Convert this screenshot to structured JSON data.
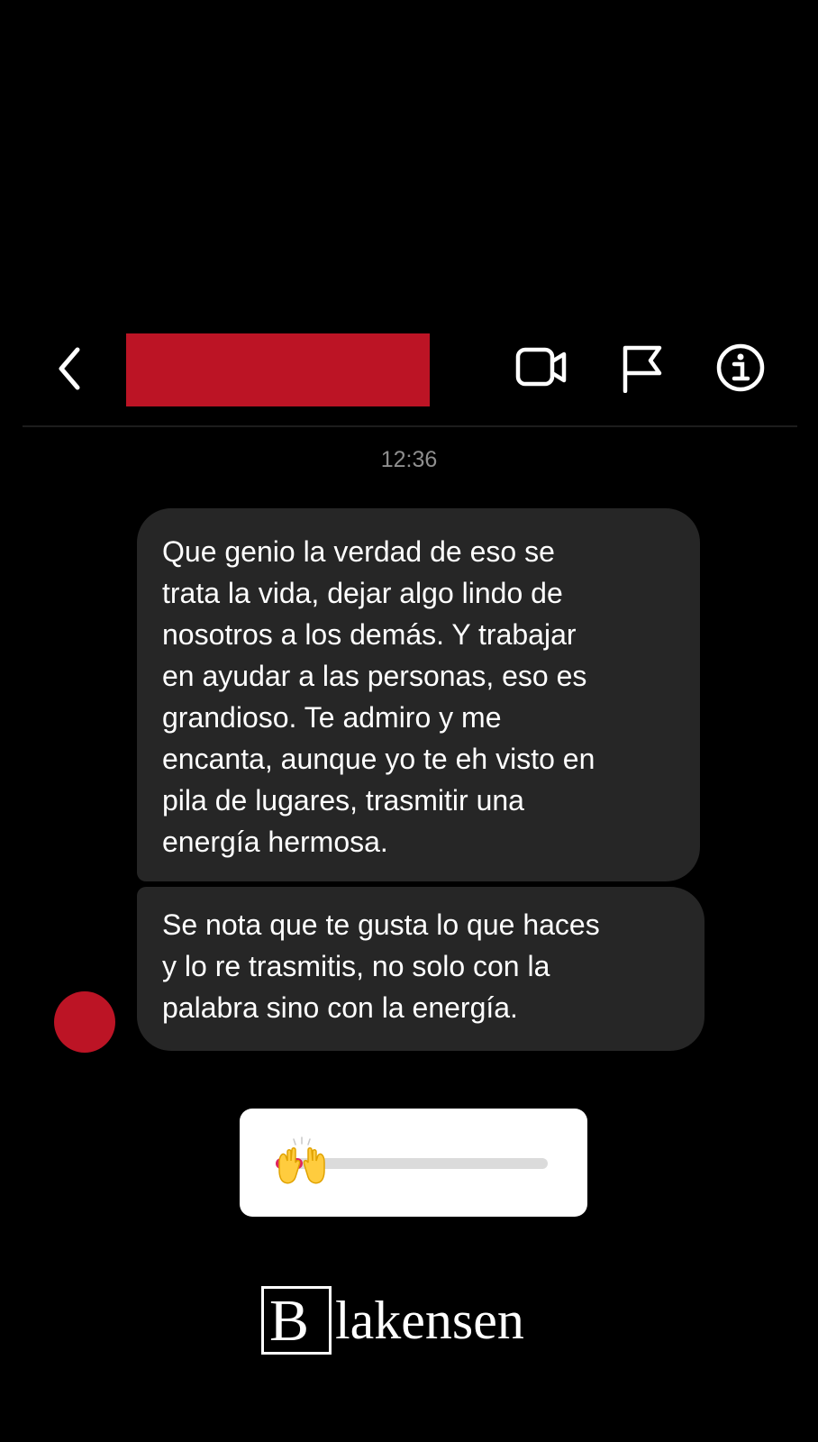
{
  "header": {
    "back_icon": "chevron-left-icon",
    "contact_name_redacted": true,
    "redaction_color": "#bc1425",
    "video_icon": "video-camera-icon",
    "flag_icon": "flag-icon",
    "info_icon": "info-circle-icon"
  },
  "thread": {
    "timestamp": "12:36",
    "messages": [
      {
        "text": "Que genio la verdad de eso se\ntrata la vida, dejar algo lindo de\nnosotros a los demás.  Y trabajar\nen ayudar a las personas, eso es\ngrandioso.  Te admiro y me\nencanta, aunque yo te eh visto en\npila de lugares, trasmitir una\nenergía hermosa."
      },
      {
        "text": "Se nota que te gusta lo que haces\ny lo re trasmitis, no solo con la\npalabra sino con la energía."
      }
    ],
    "avatar_color": "#bc1425",
    "bubble_color": "#262626"
  },
  "emoji_slider": {
    "emoji": "raising-hands-icon",
    "level": 0.1,
    "fill_color": "#e0245e",
    "track_color": "#dbdbdb"
  },
  "watermark": {
    "letter": "B",
    "rest": "lakensen"
  }
}
